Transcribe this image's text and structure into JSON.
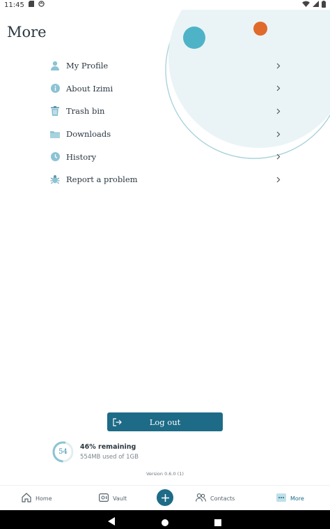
{
  "status_bar": {
    "time": "11:45"
  },
  "page": {
    "title": "More"
  },
  "menu": {
    "items": [
      {
        "label": "My Profile",
        "icon": "person-icon"
      },
      {
        "label": "About Izimi",
        "icon": "info-icon"
      },
      {
        "label": "Trash bin",
        "icon": "trash-icon"
      },
      {
        "label": "Downloads",
        "icon": "folder-icon"
      },
      {
        "label": "History",
        "icon": "clock-icon"
      },
      {
        "label": "Report a problem",
        "icon": "bug-icon"
      }
    ]
  },
  "logout": {
    "label": "Log out"
  },
  "storage": {
    "used_percent": 54,
    "ring_label": "54",
    "remaining": "46% remaining",
    "used_text": "554MB used of 1GB"
  },
  "version": "Version 0.6.0 (1)",
  "bottom_nav": {
    "home": "Home",
    "vault": "Vault",
    "contacts": "Contacts",
    "more": "More"
  },
  "colors": {
    "accent": "#1d6b86",
    "light_accent": "#8cc3d4",
    "decor_orange": "#e06a2c",
    "decor_teal": "#4fb3c8",
    "decor_bg": "#eaf4f6"
  }
}
